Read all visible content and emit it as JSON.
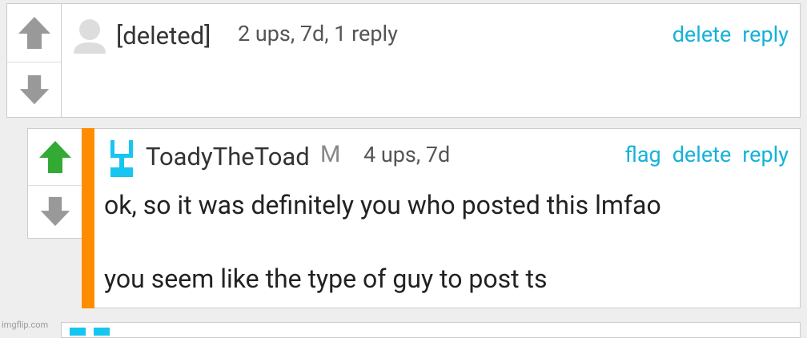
{
  "comment1": {
    "author": "[deleted]",
    "meta": "2 ups, 7d, 1 reply",
    "actions": {
      "delete": "delete",
      "reply": "reply"
    }
  },
  "comment2": {
    "author": "ToadyTheToad",
    "mod_badge": "M",
    "meta": "4 ups, 7d",
    "actions": {
      "flag": "flag",
      "delete": "delete",
      "reply": "reply"
    },
    "body_line1": "ok, so it was definitely you who posted this lmfao",
    "body_line2": "you seem like the type of guy to post ts"
  },
  "colors": {
    "link": "#17b2d8",
    "upvoted": "#33aa33",
    "vote_inactive": "#999999",
    "highlight_bar": "#ff8c00"
  },
  "icons": [
    "upvote-arrow-icon",
    "downvote-arrow-icon",
    "default-avatar-icon",
    "user-avatar-icon"
  ],
  "watermark": "imgflip.com"
}
